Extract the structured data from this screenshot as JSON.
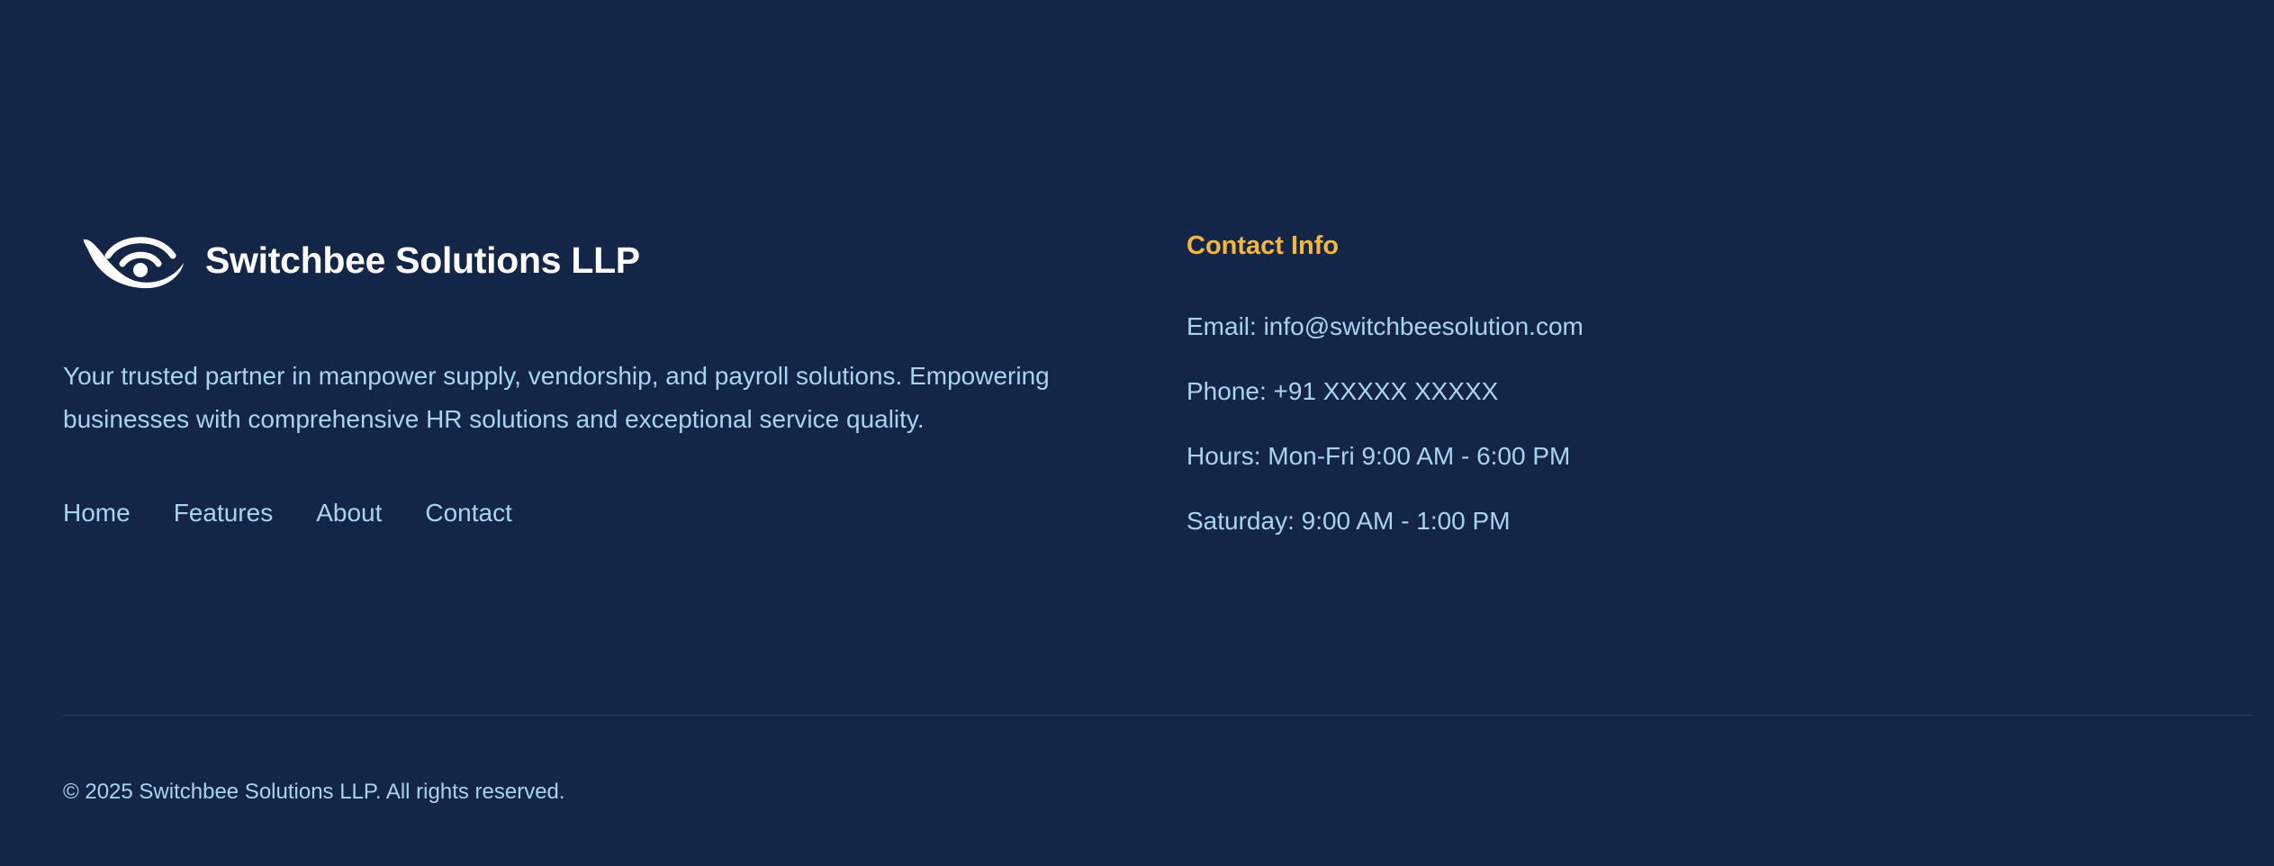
{
  "brand": {
    "logo_icon": "eye-signal-logo",
    "name": "Switchbee Solutions LLP"
  },
  "about": {
    "tagline": "Your trusted partner in manpower supply, vendorship, and payroll solutions. Empowering businesses with comprehensive HR solutions and exceptional service quality."
  },
  "nav": {
    "items": [
      {
        "label": "Home"
      },
      {
        "label": "Features"
      },
      {
        "label": "About"
      },
      {
        "label": "Contact"
      }
    ]
  },
  "contact": {
    "title": "Contact Info",
    "email": "Email: info@switchbeesolution.com",
    "phone": "Phone: +91 XXXXX XXXXX",
    "hours": "Hours: Mon-Fri 9:00 AM - 6:00 PM",
    "saturday": "Saturday: 9:00 AM - 1:00 PM"
  },
  "footer": {
    "copyright": "© 2025 Switchbee Solutions LLP. All rights reserved."
  },
  "colors": {
    "background": "#132647",
    "text": "#a9d3f2",
    "heading_accent": "#f4b63f",
    "brand_text": "#ffffff",
    "divider": "#2a3d5c"
  }
}
